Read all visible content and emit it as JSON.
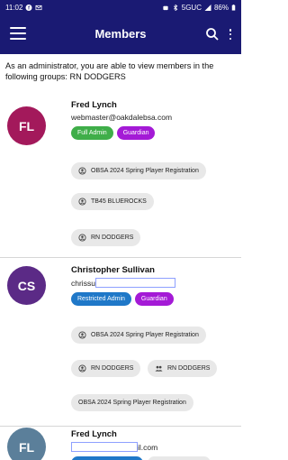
{
  "status": {
    "time": "11:02",
    "network": "5GUC",
    "battery": "86%"
  },
  "app_bar": {
    "title": "Members"
  },
  "intro_text": "As an administrator, you are able to view members in the following groups: RN DODGERS",
  "members": [
    {
      "initials": "FL",
      "avatar_color": "#a3195b",
      "name": "Fred Lynch",
      "email": "webmaster@oakdalebsa.com",
      "roles": [
        {
          "label": "Full Admin",
          "color": "#3fae49"
        },
        {
          "label": "Guardian",
          "color": "#a41ad6"
        }
      ],
      "groups": [
        "OBSA 2024 Spring Player Registration",
        "TB45 BLUEROCKS",
        "RN DODGERS"
      ]
    },
    {
      "initials": "CS",
      "avatar_color": "#5b2a86",
      "name": "Christopher Sullivan",
      "email_prefix": "chrissu",
      "roles": [
        {
          "label": "Restricted Admin",
          "color": "#1f78c8"
        },
        {
          "label": "Guardian",
          "color": "#a41ad6"
        }
      ],
      "groups": [
        "OBSA 2024 Spring Player Registration",
        "RN DODGERS",
        "RN DODGERS",
        "OBSA 2024 Spring Player Registration"
      ]
    },
    {
      "initials": "FL",
      "avatar_color": "#5b7f9a",
      "name": "Fred Lynch",
      "email_suffix": "il.com"
    }
  ]
}
